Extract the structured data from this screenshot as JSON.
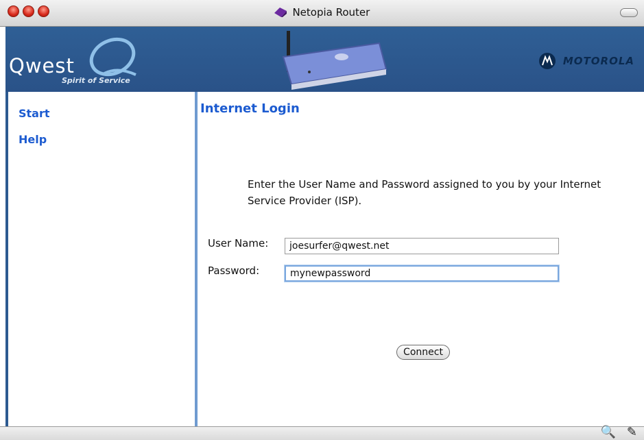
{
  "window": {
    "title": "Netopia Router"
  },
  "banner": {
    "brand": "Qwest",
    "tagline": "Spirit of Service",
    "partner": "MOTOROLA"
  },
  "sidebar": {
    "items": [
      {
        "label": "Start"
      },
      {
        "label": "Help"
      }
    ]
  },
  "main": {
    "heading": "Internet Login",
    "intro": "Enter the User Name and Password assigned to you by your Internet Service Provider (ISP).",
    "username_label": "User Name:",
    "username_value": "joesurfer@qwest.net",
    "password_label": "Password:",
    "password_value": "mynewpassword",
    "connect_label": "Connect"
  },
  "statusbar": {
    "icons": [
      "zoom-plus-icon",
      "edit-pencil-icon"
    ]
  },
  "colors": {
    "banner": "#2f5f95",
    "link": "#1c5bd0",
    "divider": "#6f9bd0"
  }
}
